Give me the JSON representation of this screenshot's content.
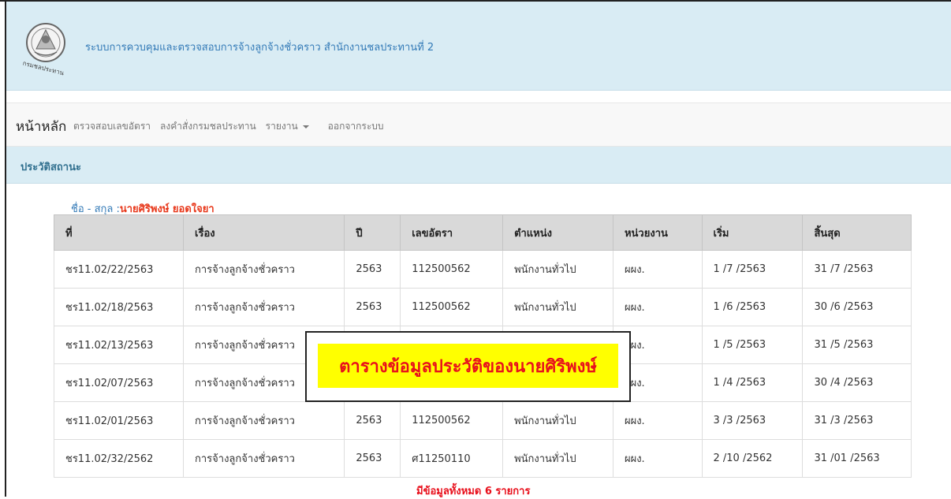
{
  "header": {
    "logo_text": "กรมชลประทาน",
    "title": "ระบบการควบคุมและตรวจสอบการจ้างลูกจ้างชั่วคราว สำนักงานชลประทานที่ 2"
  },
  "nav": {
    "brand": "หน้าหลัก",
    "links": [
      "ตรวจสอบเลขอัตรา",
      "ลงคำสั่งกรมชลประทาน",
      "รายงาน",
      "ออกจากระบบ"
    ]
  },
  "panel": {
    "title": "ประวัติสถานะ"
  },
  "person": {
    "label": "ชื่อ - สกุล :",
    "name": "นายศิริพงษ์ ยอดใจยา"
  },
  "table": {
    "headers": [
      "ที่",
      "เรื่อง",
      "ปี",
      "เลขอัตรา",
      "ตำแหน่ง",
      "หน่วยงาน",
      "เริ่ม",
      "สิ้นสุด"
    ],
    "rows": [
      [
        "ชร11.02/22/2563",
        "การจ้างลูกจ้างชั่วคราว",
        "2563",
        "112500562",
        "พนักงานทั่วไป",
        "ผผง.",
        "1 /7 /2563",
        "31 /7 /2563"
      ],
      [
        "ชร11.02/18/2563",
        "การจ้างลูกจ้างชั่วคราว",
        "2563",
        "112500562",
        "พนักงานทั่วไป",
        "ผผง.",
        "1 /6 /2563",
        "30 /6 /2563"
      ],
      [
        "ชร11.02/13/2563",
        "การจ้างลูกจ้างชั่วคราว",
        "",
        "",
        "",
        "ผผง.",
        "1 /5 /2563",
        "31 /5 /2563"
      ],
      [
        "ชร11.02/07/2563",
        "การจ้างลูกจ้างชั่วคราว",
        "",
        "",
        "",
        "ผผง.",
        "1 /4 /2563",
        "30 /4 /2563"
      ],
      [
        "ชร11.02/01/2563",
        "การจ้างลูกจ้างชั่วคราว",
        "2563",
        "112500562",
        "พนักงานทั่วไป",
        "ผผง.",
        "3 /3 /2563",
        "31 /3 /2563"
      ],
      [
        "ชร11.02/32/2562",
        "การจ้างลูกจ้างชั่วคราว",
        "2563",
        "ศ11250110",
        "พนักงานทั่วไป",
        "ผผง.",
        "2 /10 /2562",
        "31 /01 /2563"
      ]
    ]
  },
  "overlay": {
    "text": "ตารางข้อมูลประวัติของนายศิริพงษ์"
  },
  "footer": {
    "total_text": "มีข้อมูลทั้งหมด 6 รายการ"
  },
  "colors": {
    "header_bg": "#d9ecf4",
    "link": "#337ab7",
    "alert": "#e8101c",
    "highlight": "#ffff00"
  }
}
